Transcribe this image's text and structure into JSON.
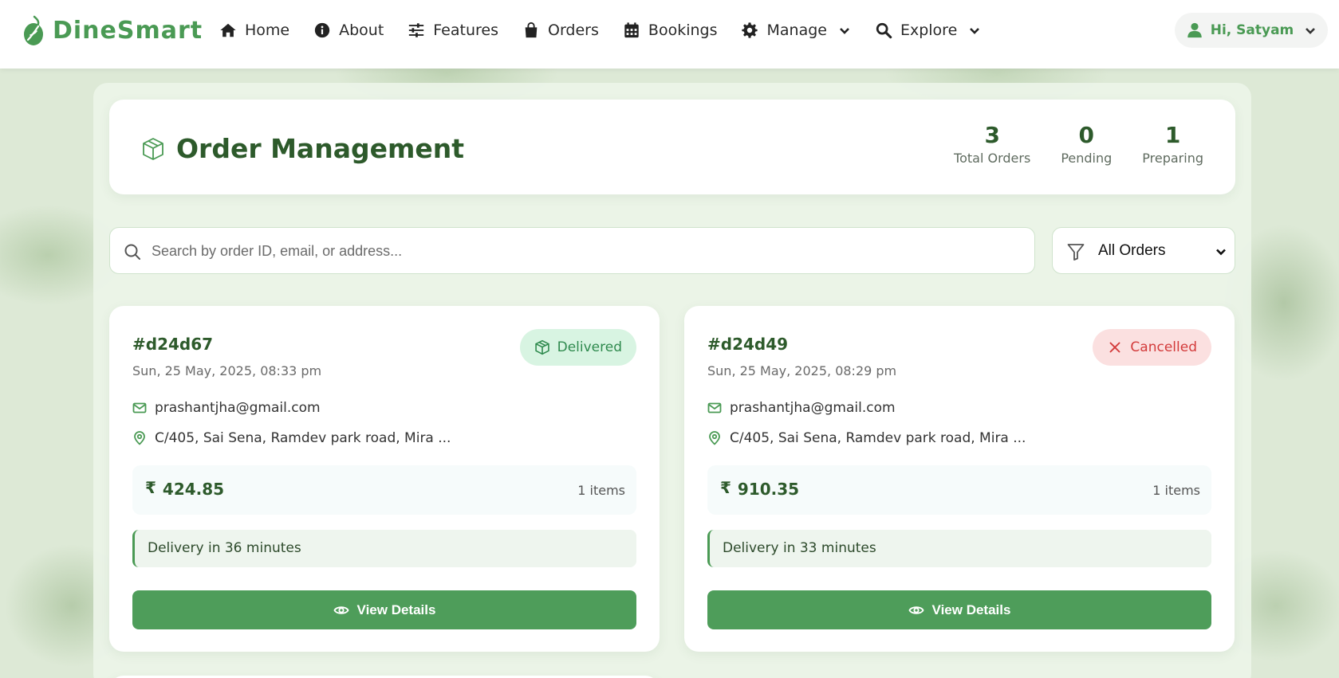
{
  "navbar": {
    "brand": "DineSmart",
    "items": [
      {
        "label": "Home",
        "icon": "home-icon"
      },
      {
        "label": "About",
        "icon": "info-icon"
      },
      {
        "label": "Features",
        "icon": "sliders-icon"
      },
      {
        "label": "Orders",
        "icon": "shopping-bag-icon"
      },
      {
        "label": "Bookings",
        "icon": "calendar-icon"
      },
      {
        "label": "Manage",
        "icon": "gear-icon",
        "dropdown": true
      },
      {
        "label": "Explore",
        "icon": "search-icon",
        "dropdown": true
      }
    ],
    "user_greeting": "Hi, Satyam"
  },
  "header": {
    "title": "Order Management",
    "stats": [
      {
        "value": "3",
        "label": "Total Orders"
      },
      {
        "value": "0",
        "label": "Pending"
      },
      {
        "value": "1",
        "label": "Preparing"
      }
    ]
  },
  "search": {
    "placeholder": "Search by order ID, email, or address...",
    "value": ""
  },
  "filter": {
    "selected": "All Orders"
  },
  "orders": [
    {
      "id": "#d24d67",
      "date": "Sun, 25 May, 2025, 08:33 pm",
      "status": "Delivered",
      "email": "prashantjha@gmail.com",
      "address": "C/405, Sai Sena, Ramdev park road, Mira ...",
      "currency_symbol": "₹",
      "amount": "424.85",
      "items": "1 items",
      "delivery": "Delivery in 36 minutes",
      "button": "View Details"
    },
    {
      "id": "#d24d49",
      "date": "Sun, 25 May, 2025, 08:29 pm",
      "status": "Cancelled",
      "email": "prashantjha@gmail.com",
      "address": "C/405, Sai Sena, Ramdev park road, Mira ...",
      "currency_symbol": "₹",
      "amount": "910.35",
      "items": "1 items",
      "delivery": "Delivery in 33 minutes",
      "button": "View Details"
    }
  ],
  "colors": {
    "brand_green": "#4a9a54",
    "title_green": "#2d5a2b",
    "button_green": "#4e9d5a",
    "delivered_bg": "#d8f4e2",
    "cancelled_bg": "#fbe0e0",
    "cancelled_text": "#d33b3b"
  }
}
